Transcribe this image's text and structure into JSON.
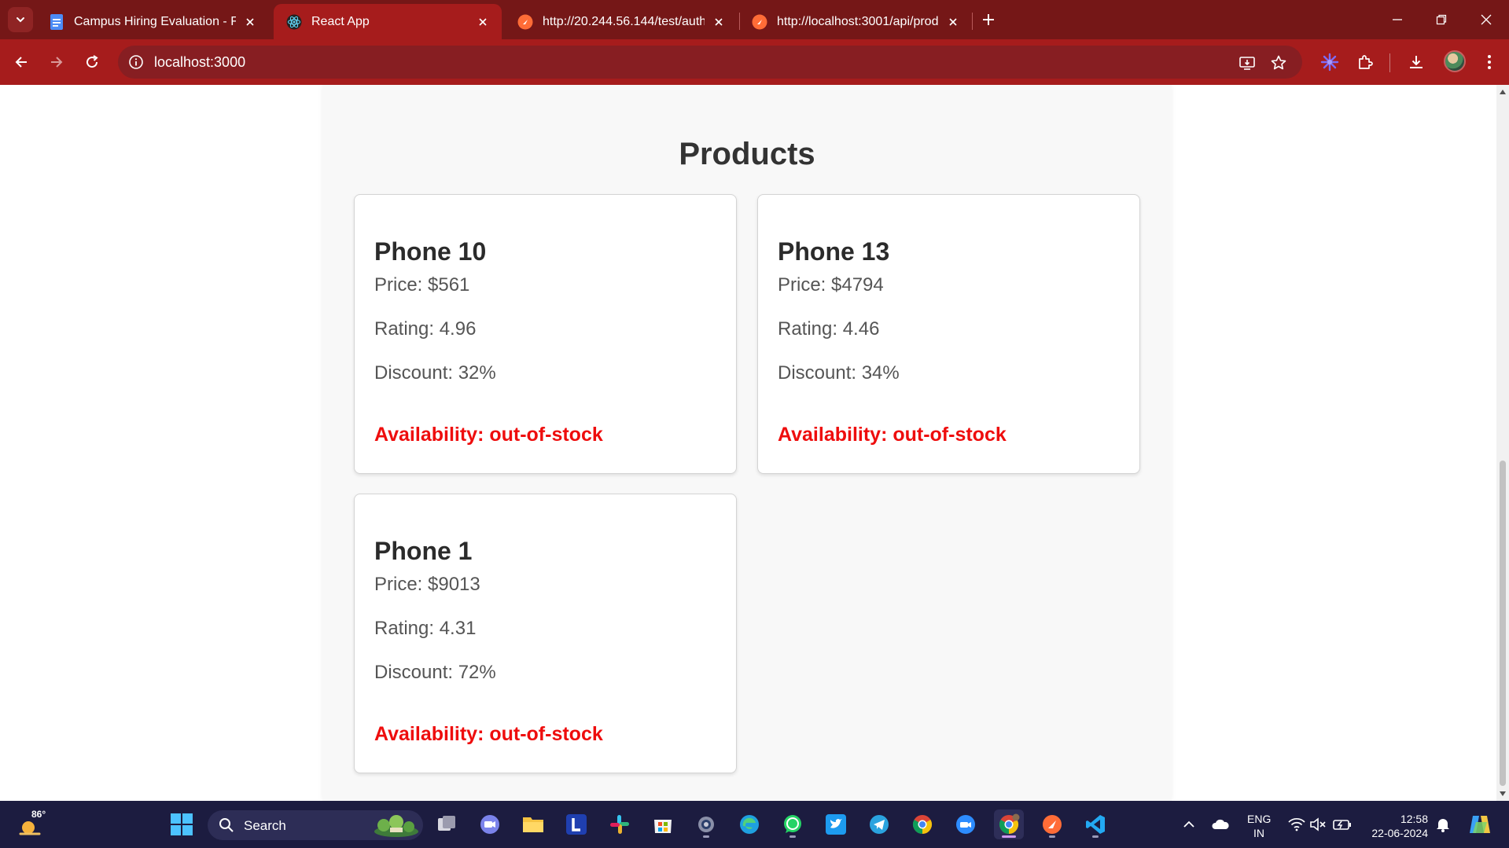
{
  "browser": {
    "tabs": [
      {
        "title": "Campus Hiring Evaluation - Full",
        "icon": "docs-icon"
      },
      {
        "title": "React App",
        "icon": "react-icon"
      },
      {
        "title": "http://20.244.56.144/test/auth",
        "icon": "postman-icon"
      },
      {
        "title": "http://localhost:3001/api/produ",
        "icon": "postman-icon"
      }
    ],
    "address": "localhost:3000",
    "accent_color": "#a61c1c",
    "tabstrip_color": "#751717"
  },
  "page": {
    "title": "Products",
    "products": [
      {
        "name": "Phone 10",
        "price": "Price: $561",
        "rating": "Rating: 4.96",
        "discount": "Discount: 32%",
        "availability": "Availability: out-of-stock"
      },
      {
        "name": "Phone 13",
        "price": "Price: $4794",
        "rating": "Rating: 4.46",
        "discount": "Discount: 34%",
        "availability": "Availability: out-of-stock"
      },
      {
        "name": "Phone 1",
        "price": "Price: $9013",
        "rating": "Rating: 4.31",
        "discount": "Discount: 72%",
        "availability": "Availability: out-of-stock"
      }
    ],
    "availability_color": "#ee0d0d"
  },
  "taskbar": {
    "weather_temp": "86°",
    "search_label": "Search",
    "apps": [
      "windows-start-icon",
      "task-view-icon",
      "meet-icon",
      "file-explorer-icon",
      "lens-app-icon",
      "slack-icon",
      "ms-store-icon",
      "settings-icon",
      "edge-icon",
      "whatsapp-icon",
      "twitter-icon",
      "telegram-icon",
      "chrome-icon",
      "zoom-icon",
      "chrome-profile-icon",
      "postman-icon",
      "vscode-icon"
    ],
    "lang_line1": "ENG",
    "lang_line2": "IN",
    "time": "12:58",
    "date": "22-06-2024"
  }
}
